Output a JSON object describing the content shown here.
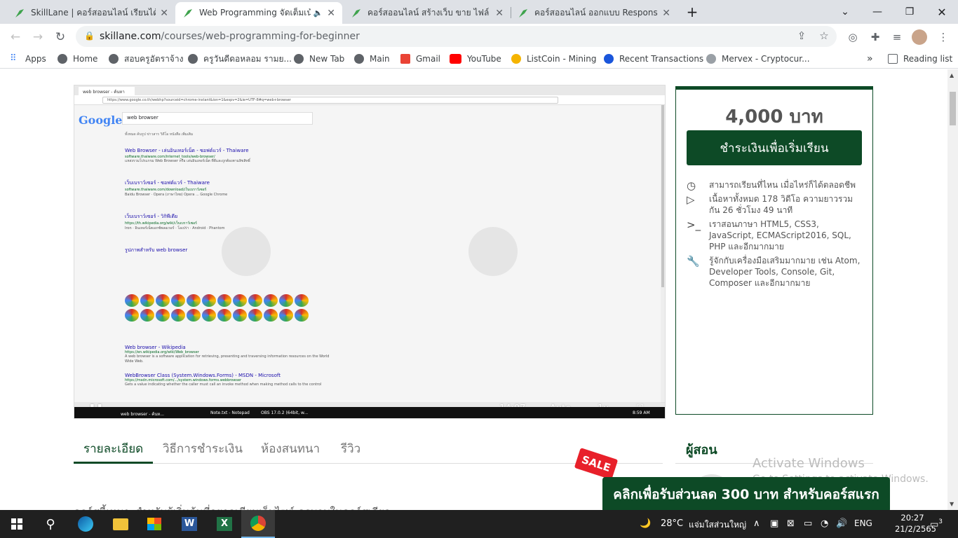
{
  "tabs": [
    {
      "title": "SkillLane | คอร์สออนไลน์ เรียนได้ทุกที่",
      "active": false
    },
    {
      "title": "Web Programming จัดเต็มเน้น",
      "active": true
    },
    {
      "title": "คอร์สออนไลน์ สร้างเว็บ ขาย ไฟล์ ออนไ",
      "active": false
    },
    {
      "title": "คอร์สออนไลน์ ออกแบบ Responsive W",
      "active": false
    }
  ],
  "browser": {
    "url_host": "skillane.com",
    "url_path": "/courses/web-programming-for-beginner"
  },
  "bookmarks": [
    "Apps",
    "Home",
    "สอบครูอัตราจ้าง",
    "ครูวันดีดอหลอม รามย...",
    "New Tab",
    "Main",
    "Gmail",
    "YouTube",
    "ListCoin - Mining",
    "Recent Transactions",
    "Mervex - Cryptocur...",
    "Reading list"
  ],
  "video": {
    "inner_tab": "web browser - ค้นหาใน...",
    "inner_url": "https://www.google.co.th/webhp?sourceid=chrome-instant&ion=1&espv=2&ie=UTF-8#q=web+browser",
    "logo": "Google",
    "search_query": "web browser",
    "nav_items": "ทั้งหมด   ค้นรูป   ข่าวสาร   วิดีโอ   หนังสือ   เพิ่มเติม",
    "results": [
      {
        "title": "Web Browser - เล่นอินเทอร์เน็ต - ซอฟต์แวร์ - Thaiware",
        "url": "software.thaiware.com/internet_tools/web-browser/",
        "desc": "แหล่งรวมโปรแกรม Web Browser หรือ เล่นอินเทอร์เน็ต ที่ดีและถูกต้องตามลิขสิทธิ์"
      },
      {
        "title": "เว็บเบราว์เซอร์ - ซอฟต์แวร์ - Thaiware",
        "url": "software.thaiware.com/download/เว็บเบราว์เซอร์",
        "desc": "Baidu Browser · Opera (ภาษาไทย) Opera ... Google Chrome"
      },
      {
        "title": "เว็บเบราว์เซอร์ - วิกิพีเดีย",
        "url": "https://th.wikipedia.org/wiki/เว็บเบราว์เซอร์",
        "desc": "Iron · อินเทอร์เน็ตเอกซ์พลอเรอร์ · โอเปร่า · Android · Phantom"
      },
      {
        "title": "รูปภาพสำหรับ web browser",
        "url": "",
        "desc": ""
      }
    ],
    "results2": [
      {
        "title": "Web browser - Wikipedia",
        "url": "https://en.wikipedia.org/wiki/Web_browser",
        "desc": "A web browser is a software application for retrieving, presenting and traversing information resources on the World Wide Web."
      },
      {
        "title": "WebBrowser Class (System.Windows.Forms) - MSDN - Microsoft",
        "url": "https://msdn.microsoft.com/.../system.windows.forms.webbrowser",
        "desc": "Gets a value indicating whether the caller must call an invoke method when making method calls to the control"
      }
    ],
    "time": "14:07",
    "quality": "Auto",
    "speed": "1x",
    "inner_taskbar": [
      "web browser - ค้นห...",
      "Note.txt - Notepad",
      "OBS 17.0.2 (64bit, w..."
    ],
    "inner_clock": "8:59 AM"
  },
  "card": {
    "price": "4,000 บาท",
    "pay_button": "ชำระเงินเพื่อเริ่มเรียน",
    "features": [
      {
        "icon": "clock-icon",
        "text": "สามารถเรียนที่ไหน เมื่อไหร่ก็ได้ตลอดชีพ"
      },
      {
        "icon": "play-icon",
        "text": "เนื้อหาทั้งหมด 178 วิดีโอ ความยาวรวมกัน 26 ชั่วโมง 49 นาที"
      },
      {
        "icon": "terminal-icon",
        "text": "เราสอนภาษา HTML5, CSS3, JavaScript, ECMAScript2016, SQL, PHP และอีกมากมาย"
      },
      {
        "icon": "wrench-icon",
        "text": "รู้จักกับเครื่องมือเสริมมากมาย เช่น Atom, Developer Tools, Console, Git, Composer และอีกมากมาย"
      }
    ]
  },
  "page_tabs": [
    "รายละเอียด",
    "วิธีการชำระเงิน",
    "ห้องสนทนา",
    "รีวิว"
  ],
  "instructor_heading": "ผู้สอน",
  "activate": {
    "line1": "Activate Windows",
    "line2": "Go to Settings to activate Windows."
  },
  "sale_badge": "SALE",
  "promo": "คลิกเพื่อรับส่วนลด 300 บาท สำหรับคอร์สแรก",
  "peek_text": "คอร์สนี้เหมาะสำหรับผู้เริ่มต้นที่อยากเขียนเว็บไซต์ ครบจบในคอร์สเดียว",
  "taskbar": {
    "weather": "28°C",
    "weather_text": "แจ่มใสส่วนใหญ่",
    "lang": "ENG",
    "time": "20:27",
    "date": "21/2/2565",
    "notif": "3"
  },
  "colors": {
    "brand": "#0d4a26",
    "sale": "#e8202a"
  }
}
